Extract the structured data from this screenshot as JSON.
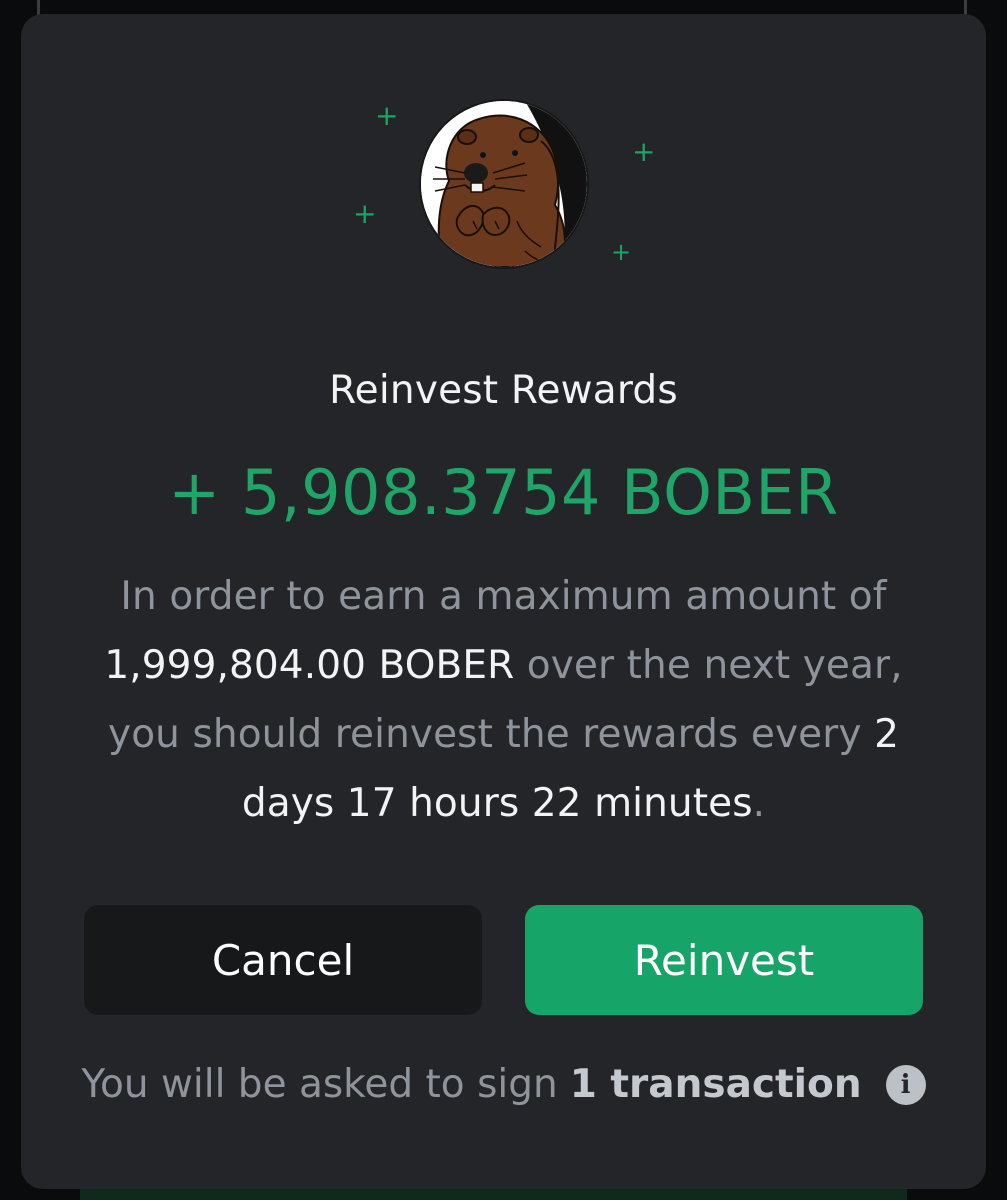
{
  "modal": {
    "title": "Reinvest Rewards",
    "amount": "+ 5,908.3754 BOBER",
    "description": {
      "part1": "In order to earn a maximum amount of ",
      "max_amount": "1,999,804.00 BOBER",
      "part2": " over the next year, you should reinvest the rewards every ",
      "interval": "2 days 17 hours 22 minutes",
      "part3": "."
    },
    "buttons": {
      "cancel_label": "Cancel",
      "reinvest_label": "Reinvest"
    },
    "footer": {
      "text": "You will be asked to sign",
      "count": "1 transaction"
    },
    "icons": {
      "avatar": "beaver-avatar-icon",
      "info": "info-icon",
      "sparkle": "sparkle-icon"
    }
  },
  "colors": {
    "modal_bg": "#242528",
    "accent_green": "#1ea567",
    "button_green": "#17a468",
    "button_dark": "#17181a",
    "muted_text": "#8e939c",
    "primary_text": "#f2f3f5"
  }
}
